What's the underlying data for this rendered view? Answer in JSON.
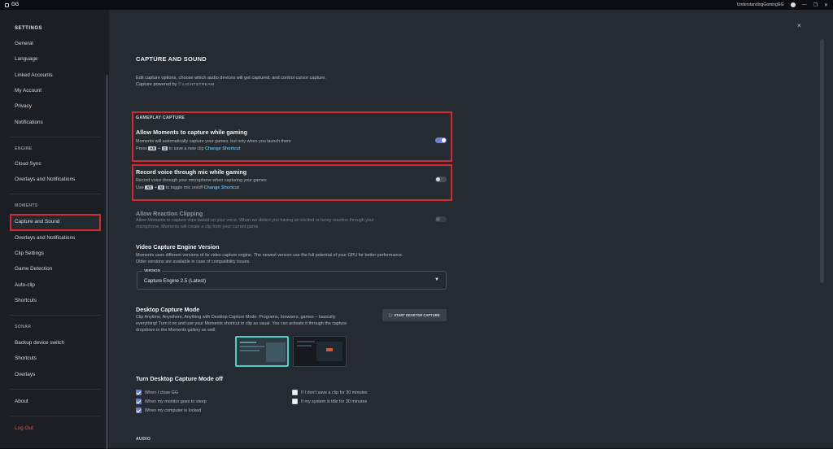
{
  "titlebar": {
    "app": "GG",
    "user": "UnderstandingGamingGG"
  },
  "sidebar": {
    "heading": "SETTINGS",
    "items_general": [
      "General",
      "Language",
      "Linked Accounts",
      "My Account",
      "Privacy",
      "Notifications"
    ],
    "engine_label": "ENGINE",
    "items_engine": [
      "Cloud Sync",
      "Overlays and Notifications"
    ],
    "moments_label": "MOMENTS",
    "items_moments": [
      "Capture and Sound",
      "Overlays and Notifications",
      "Clip Settings",
      "Game Detection",
      "Auto-clip",
      "Shortcuts"
    ],
    "sonar_label": "SONAR",
    "items_sonar": [
      "Backup device switch",
      "Shortcuts",
      "Overlays"
    ],
    "about": "About",
    "logout": "Log Out"
  },
  "main": {
    "close": "×",
    "title": "CAPTURE AND SOUND",
    "desc1": "Edit capture options, choose which audio devices will get captured, and control cursor capture.",
    "desc2": "Capture powered by",
    "lightstream": "LIGHTSTREAM",
    "gameplay_label": "GAMEPLAY CAPTURE",
    "allow_moments": {
      "title": "Allow Moments to capture while gaming",
      "desc": "Moments will automatically capture your games, but only when you launch them",
      "press": "Press",
      "k1": "Alt",
      "k2": "G",
      "tail": "to save a new clip",
      "link": "Change Shortcut",
      "on": true
    },
    "record_voice": {
      "title": "Record voice through mic while gaming",
      "desc": "Record voice through your microphone when capturing your games",
      "use": "Use",
      "k1": "Alt",
      "k2": "M",
      "tail": "to toggle mic on/off",
      "link": "Change Shortcut",
      "on": false
    },
    "reaction": {
      "title": "Allow Reaction Clipping",
      "desc1": "Allow Moments to capture clips based on your voice. When we detect you having an excited or funny reaction through your",
      "desc2": "microphone, Moments will create a clip from your current game."
    },
    "engine": {
      "title": "Video Capture Engine Version",
      "desc1": "Moments uses different versions of its video capture engine. The newest version use the full potential of your GPU for better performance.",
      "desc2": "Older versions are available in case of compatibility issues.",
      "select_label": "VERSION",
      "select_value": "Capture Engine 2.5 (Latest)"
    },
    "desktop": {
      "title": "Desktop Capture Mode",
      "desc1": "Clip Anytime, Anywhere, Anything with Desktop Capture Mode. Programs, browsers, games – basically",
      "desc2": "everything! Turn it on and use your Moments shortcut to clip as usual. You can activate it through the capture",
      "desc3": "dropdown in the Moments gallery as well.",
      "button": "START DESKTOP CAPTURE"
    },
    "turnoff": {
      "title": "Turn Desktop Capture Mode off",
      "left": [
        {
          "label": "When I close GG",
          "checked": true
        },
        {
          "label": "When my monitor goes to sleep",
          "checked": true
        },
        {
          "label": "When my computer is locked",
          "checked": true
        }
      ],
      "right": [
        {
          "label": "If I don't save a clip for 30 minutes",
          "checked": false
        },
        {
          "label": "If my system is idle for 30 minutes",
          "checked": false
        }
      ]
    },
    "audio_label": "AUDIO"
  },
  "colors": {
    "accent": "#6b7fd6",
    "highlight": "#d42a33",
    "link": "#4fb7e8"
  }
}
